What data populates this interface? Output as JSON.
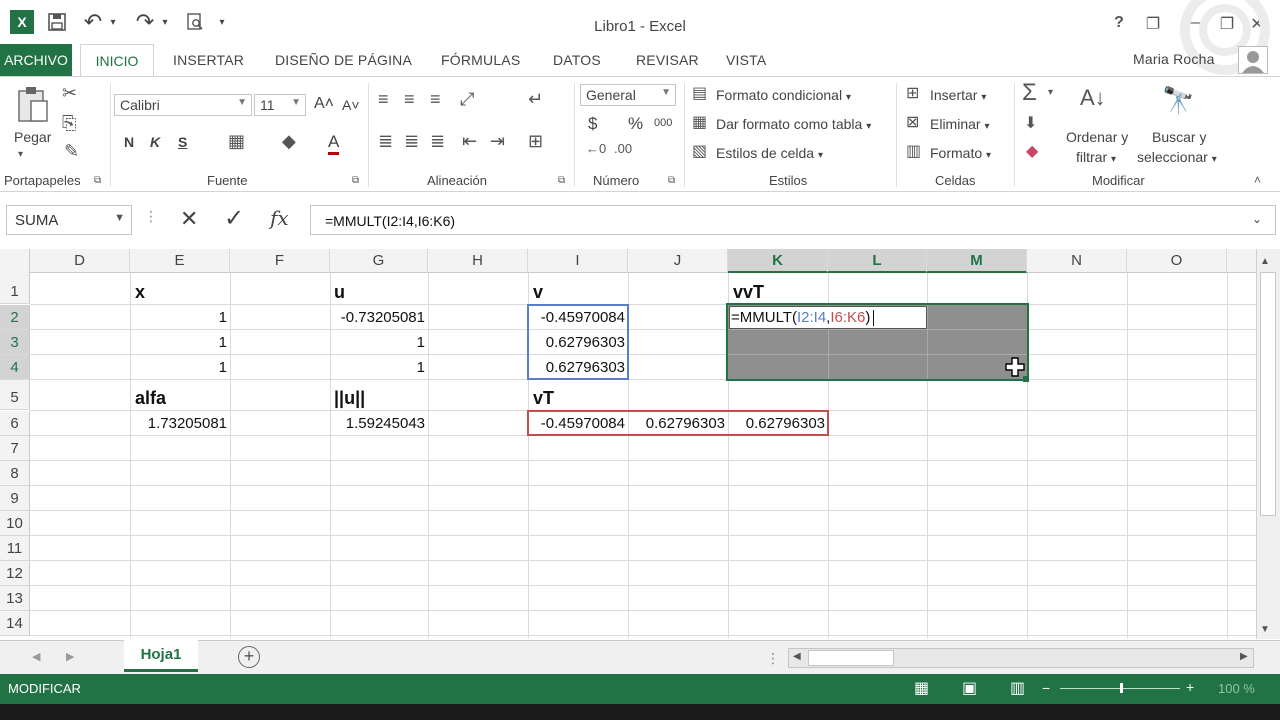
{
  "window": {
    "title": "Libro1 - Excel",
    "user": "Maria Rocha",
    "help": "?",
    "minimize": "—",
    "restore": "❐",
    "close": "✕"
  },
  "qat": {
    "excel_icon": "X",
    "save": "💾",
    "undo": "↶",
    "redo": "↷",
    "more": "▾"
  },
  "ribbon_tabs": [
    "ARCHIVO",
    "INICIO",
    "INSERTAR",
    "DISEÑO DE PÁGINA",
    "FÓRMULAS",
    "DATOS",
    "REVISAR",
    "VISTA"
  ],
  "ribbon": {
    "clipboard": {
      "paste": "Pegar",
      "group": "Portapapeles"
    },
    "font": {
      "name": "Calibri",
      "size": "11",
      "bold": "N",
      "italic": "K",
      "underline": "S",
      "group": "Fuente",
      "grow": "A˄",
      "shrink": "A˅",
      "color_a": "A"
    },
    "alignment": {
      "group": "Alineación"
    },
    "number": {
      "format": "General",
      "currency": "$",
      "percent": "%",
      "thousands": "000",
      "group": "Número"
    },
    "styles": {
      "conditional": "Formato condicional",
      "as_table": "Dar formato como tabla",
      "cell_styles": "Estilos de celda",
      "group": "Estilos"
    },
    "cells": {
      "insert": "Insertar",
      "delete": "Eliminar",
      "format": "Formato",
      "group": "Celdas"
    },
    "editing": {
      "sort_1": "Ordenar y",
      "sort_2": "filtrar",
      "find_1": "Buscar y",
      "find_2": "seleccionar",
      "group": "Modificar"
    }
  },
  "formula_bar": {
    "name_box": "SUMA",
    "cancel": "✕",
    "enter": "✓",
    "fx": "fx",
    "formula": "=MMULT(I2:I4,I6:K6)"
  },
  "columns": [
    "D",
    "E",
    "F",
    "G",
    "H",
    "I",
    "J",
    "K",
    "L",
    "M",
    "N",
    "O"
  ],
  "rows": [
    "1",
    "2",
    "3",
    "4",
    "5",
    "6",
    "7",
    "8",
    "9",
    "10",
    "11",
    "12",
    "13",
    "14"
  ],
  "cells": {
    "E1": "x",
    "G1": "u",
    "I1": "v",
    "K1": "vvT",
    "E2": "1",
    "G2": "-0.73205081",
    "I2": "-0.45970084",
    "E3": "1",
    "G3": "1",
    "I3": "0.62796303",
    "E4": "1",
    "G4": "1",
    "I4": "0.62796303",
    "E5": "alfa",
    "G5": "||u||",
    "I5": "vT",
    "E6": "1.73205081",
    "G6": "1.59245043",
    "I6": "-0.45970084",
    "J6": "0.62796303",
    "K6": "0.62796303"
  },
  "edit_cell": {
    "prefix": "=MMULT(",
    "ref1": "I2:I4",
    "comma": ",",
    "ref2": "I6:K6",
    "suffix": ")"
  },
  "sheet": {
    "tab": "Hoja1",
    "add": "+"
  },
  "status": {
    "mode": "MODIFICAR",
    "zoom": "100 %"
  },
  "colors": {
    "excel_green": "#217346",
    "ref_blue": "#5b7fc6",
    "ref_red": "#c0504d"
  }
}
